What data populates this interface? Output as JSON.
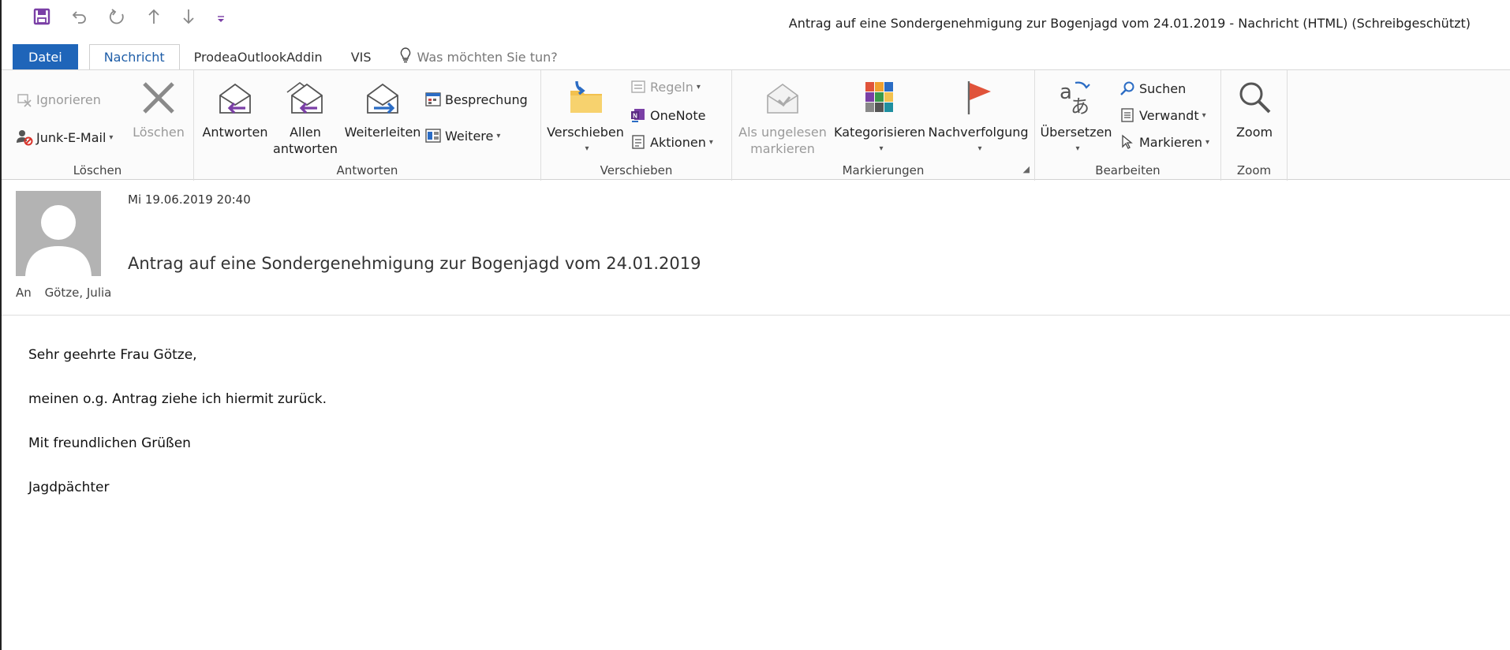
{
  "window": {
    "title": "Antrag auf eine Sondergenehmigung zur Bogenjagd vom 24.01.2019 - Nachricht (HTML) (Schreibgeschützt)"
  },
  "quick_access": {
    "icons": [
      "save-icon",
      "undo-icon",
      "redo-icon",
      "arrow-up-icon",
      "arrow-down-icon",
      "customize-qat-icon"
    ]
  },
  "tabs": [
    {
      "label": "Datei"
    },
    {
      "label": "Nachricht"
    },
    {
      "label": "ProdeaOutlookAddin"
    },
    {
      "label": "VIS"
    }
  ],
  "tell_me": "Was möchten Sie tun?",
  "ribbon": {
    "loeschen": {
      "label": "Löschen",
      "ignore": "Ignorieren",
      "delete": "Löschen",
      "junk": "Junk-E-Mail"
    },
    "antworten": {
      "label": "Antworten",
      "reply": "Antworten",
      "reply_all_1": "Allen",
      "reply_all_2": "antworten",
      "forward": "Weiterleiten",
      "meeting": "Besprechung",
      "more": "Weitere"
    },
    "verschieben": {
      "label": "Verschieben",
      "move": "Verschieben",
      "rules": "Regeln",
      "onenote": "OneNote",
      "actions": "Aktionen"
    },
    "markierungen": {
      "label": "Markierungen",
      "unread_1": "Als ungelesen",
      "unread_2": "markieren",
      "categorize": "Kategorisieren",
      "followup": "Nachverfolgung"
    },
    "bearbeiten": {
      "label": "Bearbeiten",
      "translate": "Übersetzen",
      "search": "Suchen",
      "related": "Verwandt",
      "select": "Markieren"
    },
    "zoom": {
      "label": "Zoom",
      "zoom": "Zoom"
    }
  },
  "message": {
    "date": "Mi 19.06.2019 20:40",
    "subject": "Antrag auf eine Sondergenehmigung zur Bogenjagd vom 24.01.2019",
    "to_label": "An",
    "to_name": "Götze, Julia",
    "body": [
      "Sehr geehrte Frau Götze,",
      "meinen o.g. Antrag ziehe ich hiermit zurück.",
      "Mit freundlichen Grüßen",
      "Jagdpächter"
    ]
  },
  "colors": {
    "accent": "#1f65b9",
    "flag": "#e0533a",
    "reply_arrow": "#7a3fa6",
    "forward_arrow": "#2b6cc4"
  }
}
